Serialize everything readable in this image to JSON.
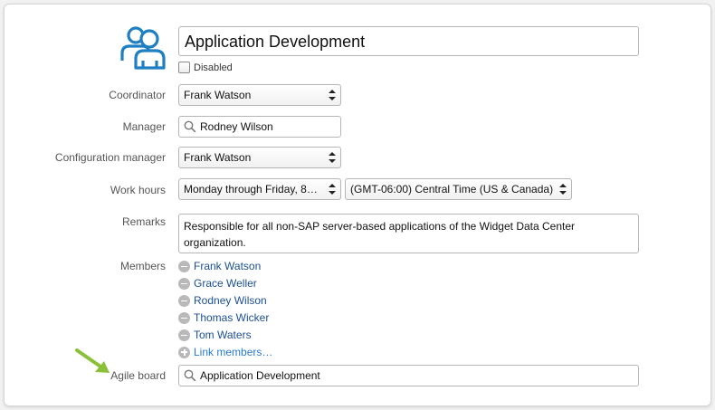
{
  "team": {
    "name": "Application Development",
    "disabled_label": "Disabled"
  },
  "fields": {
    "coordinator": {
      "label": "Coordinator",
      "value": "Frank Watson"
    },
    "manager": {
      "label": "Manager",
      "value": "Rodney Wilson"
    },
    "configuration_manager": {
      "label": "Configuration manager",
      "value": "Frank Watson"
    },
    "work_hours": {
      "label": "Work hours",
      "value": "Monday through Friday, 8…",
      "timezone": "(GMT-06:00) Central Time (US & Canada)"
    },
    "remarks": {
      "label": "Remarks",
      "value": "Responsible for all non-SAP server-based applications of the Widget Data Center organization."
    },
    "members": {
      "label": "Members",
      "items": [
        "Frank Watson",
        "Grace Weller",
        "Rodney Wilson",
        "Thomas Wicker",
        "Tom Waters"
      ],
      "link_label": "Link members…"
    },
    "agile_board": {
      "label": "Agile board",
      "value": "Application Development"
    }
  },
  "colors": {
    "icon_blue": "#1e7fc2",
    "link": "#1c4f93",
    "arrow_green": "#8bc03b"
  },
  "icons": [
    "team-icon",
    "search-icon",
    "remove-member-icon",
    "add-member-icon",
    "green-arrow-icon"
  ]
}
